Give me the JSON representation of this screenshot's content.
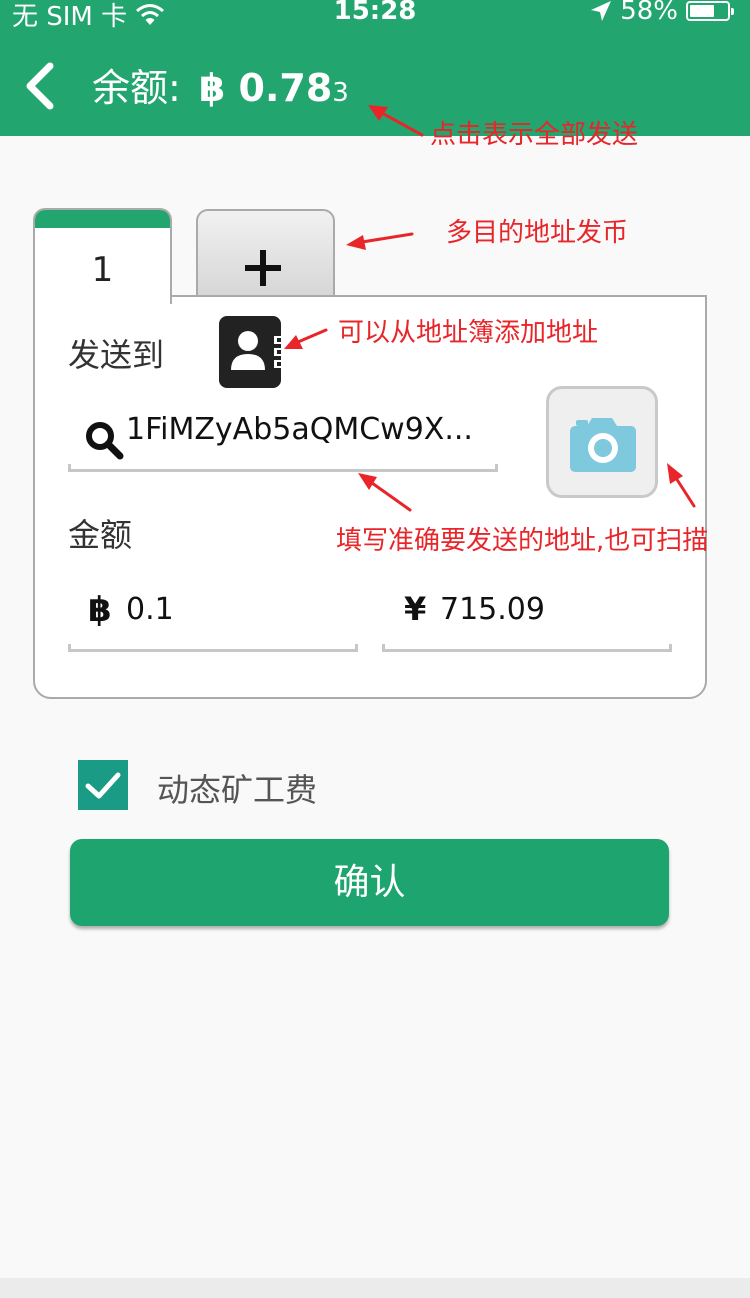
{
  "status_bar": {
    "carrier": "无 SIM 卡",
    "time": "15:28",
    "battery": "58%"
  },
  "header": {
    "title": "余额:",
    "currency_symbol": "฿",
    "balance_main": "0.78",
    "balance_tail": "3"
  },
  "tabs": [
    {
      "label": "1",
      "active": true
    },
    {
      "label": "+",
      "active": false,
      "icon": "plus-icon"
    }
  ],
  "form": {
    "send_to_label": "发送到",
    "address_value": "1FiMZyAb5aQMCw9X...",
    "amount_label": "金额",
    "btc_symbol": "฿",
    "btc_value": "0.1",
    "cny_symbol": "¥",
    "cny_value": "715.09"
  },
  "fee": {
    "label": "动态矿工费",
    "checked": true
  },
  "confirm_label": "确认",
  "annotations": {
    "send_all": "点击表示全部发送",
    "multi_address": "多目的地址发币",
    "address_book": "可以从地址簿添加地址",
    "fill_address": "填写准确要发送的地址,也可扫描"
  },
  "colors": {
    "header": "#23a56f",
    "confirm": "#1ea46e",
    "checkbox": "#1a9b85",
    "annotation": "#e8262a"
  }
}
